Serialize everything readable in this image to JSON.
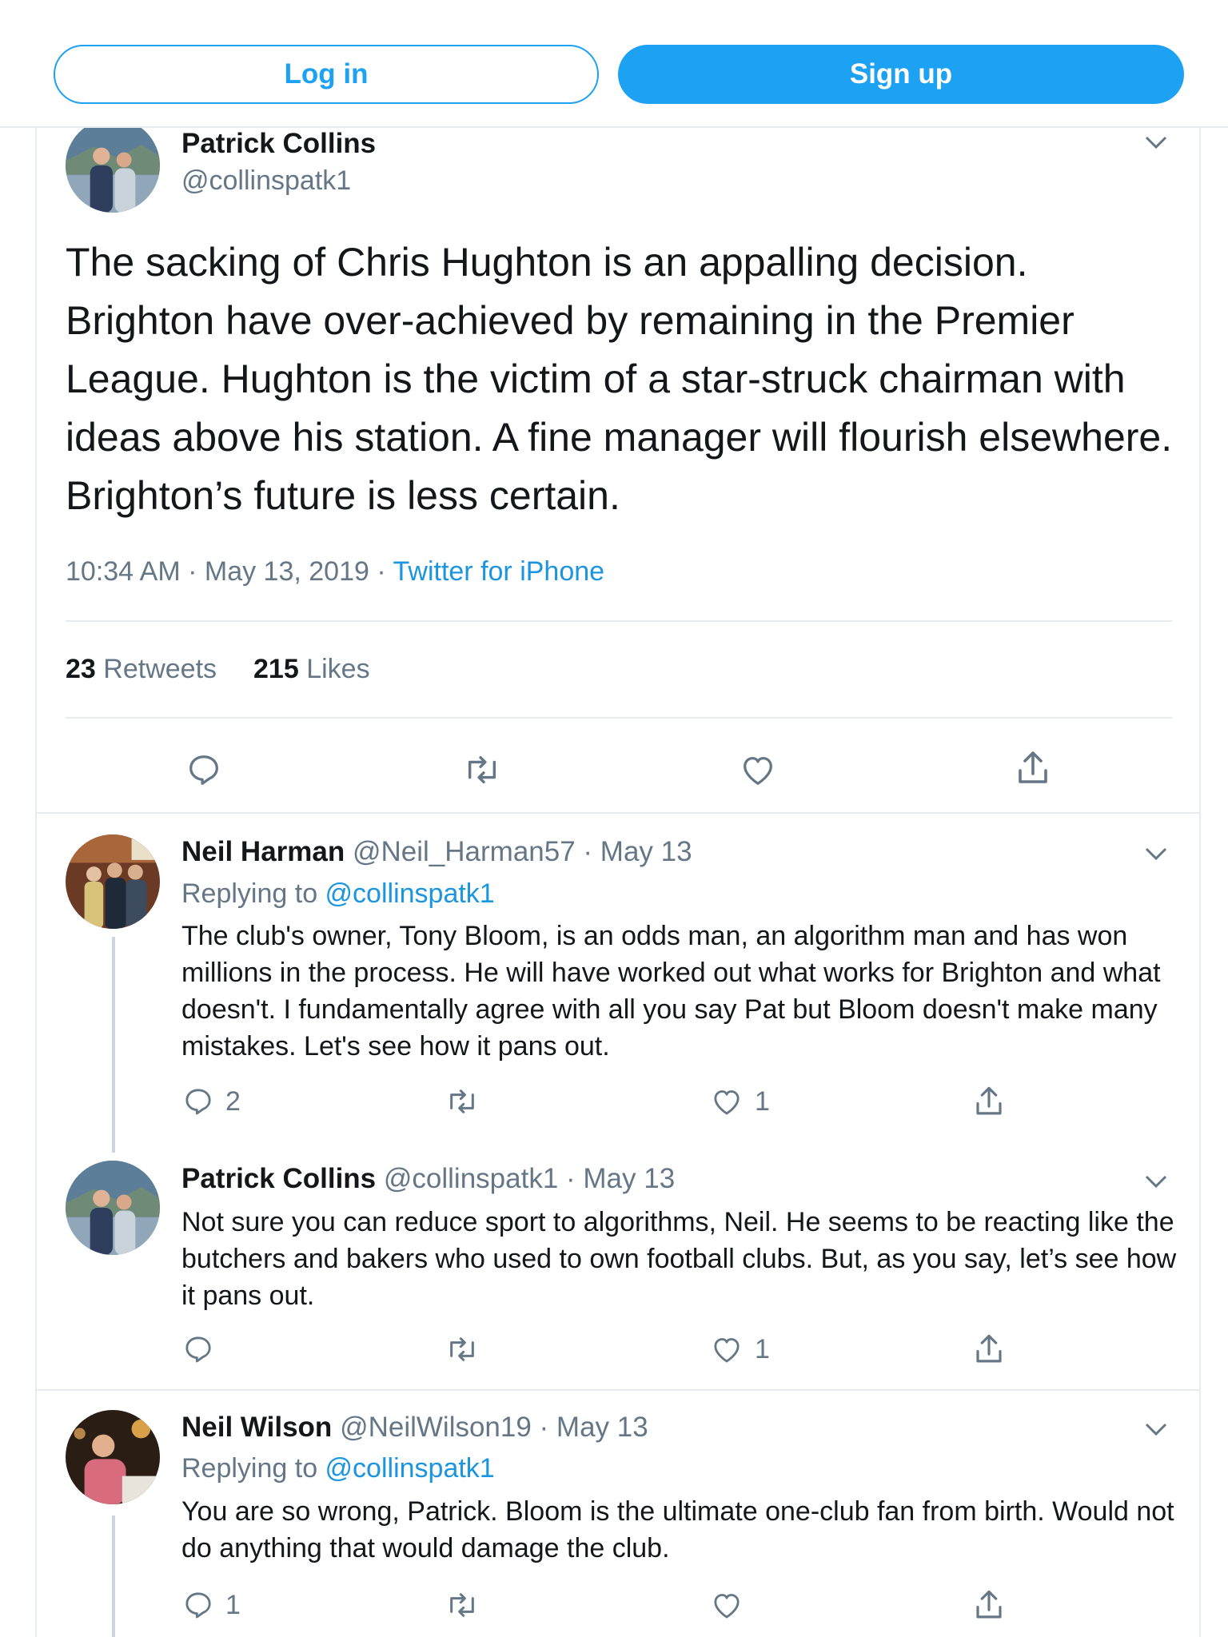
{
  "auth": {
    "login_label": "Log in",
    "signup_label": "Sign up"
  },
  "main_tweet": {
    "name": "Patrick Collins",
    "handle": "@collinspatk1",
    "text": "The sacking of Chris Hughton is an appalling decision. Brighton have  over-achieved by remaining in the Premier League. Hughton is the victim of a star-struck chairman with ideas above his station. A fine manager will flourish elsewhere. Brighton’s future is less certain.",
    "time": "10:34 AM · May 13, 2019 · ",
    "source": "Twitter for iPhone",
    "retweets_count": "23",
    "retweets_label": "Retweets",
    "likes_count": "215",
    "likes_label": "Likes"
  },
  "replies": [
    {
      "name": "Neil Harman",
      "meta": "@Neil_Harman57 · May 13",
      "replying_prefix": "Replying to ",
      "replying_to": "@collinspatk1",
      "text": "The club's owner, Tony Bloom, is an odds man, an algorithm man and has won millions in the process. He will have worked out what works for Brighton and what doesn't. I fundamentally agree with all you say Pat but Bloom doesn't make many mistakes. Let's see how it pans out.",
      "reply_count": "2",
      "retweet_count": "",
      "like_count": "1"
    },
    {
      "name": "Patrick Collins",
      "meta": "@collinspatk1 · May 13",
      "text": "Not sure you can reduce sport to algorithms, Neil. He seems to be reacting like the butchers and bakers who used to own football clubs. But, as you say, let’s see how it pans out.",
      "reply_count": "",
      "retweet_count": "",
      "like_count": "1"
    },
    {
      "name": "Neil Wilson",
      "meta": "@NeilWilson19 · May 13",
      "replying_prefix": "Replying to ",
      "replying_to": "@collinspatk1",
      "text": "You are so wrong, Patrick. Bloom is the ultimate one-club fan from birth. Would not do anything that would damage the club.",
      "reply_count": "1",
      "retweet_count": "",
      "like_count": ""
    }
  ],
  "icons": {
    "reply": "reply-icon",
    "retweet": "retweet-icon",
    "like": "heart-icon",
    "share": "share-icon",
    "more": "chevron-down-icon"
  },
  "colors": {
    "accent": "#1da1f2",
    "link": "#1b95e0",
    "muted": "#657786",
    "text": "#14171a"
  }
}
